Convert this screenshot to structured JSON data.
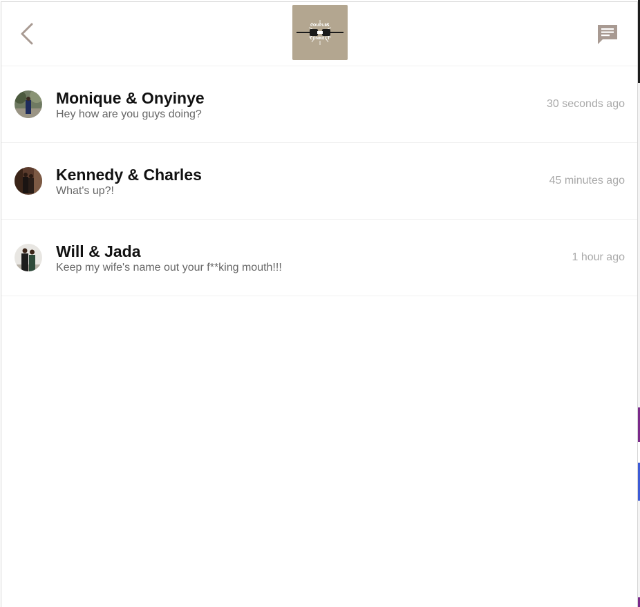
{
  "header": {
    "back_icon": "chevron-left-icon",
    "logo_text_top": "COUPLES",
    "logo_text_bottom": "CONNECT",
    "chat_icon": "chat-bubble-icon",
    "logo_bg": "#b3a690",
    "icon_color": "#a89a92"
  },
  "conversations": [
    {
      "name": "Monique & Onyinye",
      "message": "Hey how are you guys doing?",
      "time": "30 seconds ago"
    },
    {
      "name": "Kennedy & Charles",
      "message": "What's up?!",
      "time": "45 minutes ago"
    },
    {
      "name": "Will & Jada",
      "message": "Keep my wife's name out your f**king mouth!!!",
      "time": "1 hour ago"
    }
  ]
}
